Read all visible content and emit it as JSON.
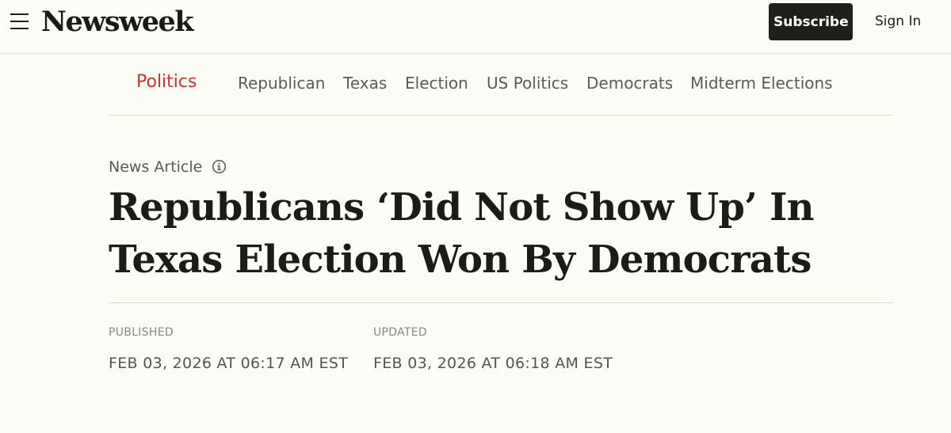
{
  "header": {
    "logo": "Newsweek",
    "subscribe_label": "Subscribe",
    "signin_label": "Sign In"
  },
  "topics": {
    "primary": "Politics",
    "items": [
      "Republican",
      "Texas",
      "Election",
      "US Politics",
      "Democrats",
      "Midterm Elections"
    ]
  },
  "article": {
    "type": "News Article",
    "headline": "Republicans ‘Did Not Show Up’ In Texas Election Won By Democrats",
    "published_label": "PUBLISHED",
    "published_value": "FEB 03, 2026 AT 06:17 AM EST",
    "updated_label": "UPDATED",
    "updated_value": "FEB 03, 2026 AT 06:18 AM EST"
  },
  "icons": {
    "menu": "hamburger-menu-icon",
    "info": "info-circle-icon"
  },
  "colors": {
    "background": "#fcfbf6",
    "accent": "#d0312d",
    "button": "#1f1e1b",
    "muted_text": "#5d5b55"
  }
}
